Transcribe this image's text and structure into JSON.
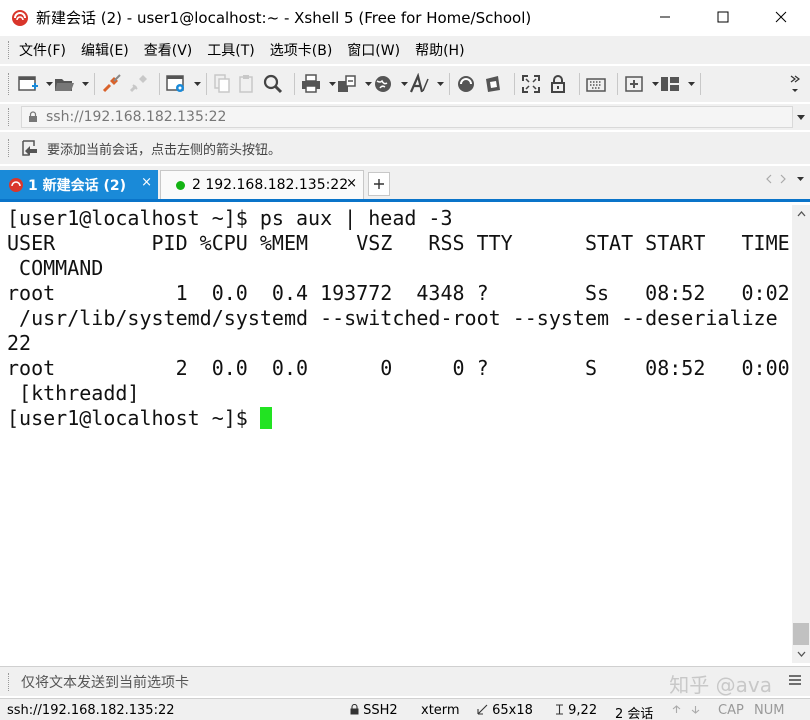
{
  "window": {
    "title": "新建会话 (2) - user1@localhost:~ - Xshell 5 (Free for Home/School)"
  },
  "menu": [
    "文件(F)",
    "编辑(E)",
    "查看(V)",
    "工具(T)",
    "选项卡(B)",
    "窗口(W)",
    "帮助(H)"
  ],
  "address": {
    "value": "ssh://192.168.182.135:22"
  },
  "hint": {
    "text": "要添加当前会话，点击左侧的箭头按钮。"
  },
  "tabs": [
    {
      "label": "1 新建会话 (2)",
      "active": true
    },
    {
      "label": "2 192.168.182.135:22",
      "active": false,
      "status_color": "#13b313"
    }
  ],
  "terminal": {
    "lines": [
      "[user1@localhost ~]$ ps aux | head -3",
      "USER        PID %CPU %MEM    VSZ   RSS TTY      STAT START   TIME",
      " COMMAND",
      "root          1  0.0  0.4 193772  4348 ?        Ss   08:52   0:02",
      " /usr/lib/systemd/systemd --switched-root --system --deserialize",
      "22",
      "root          2  0.0  0.0      0     0 ?        S    08:52   0:00",
      " [kthreadd]"
    ],
    "prompt": "[user1@localhost ~]$ ",
    "cursor_color": "#22e322"
  },
  "compose": {
    "placeholder": "仅将文本发送到当前选项卡",
    "watermark": "知乎 @ava"
  },
  "status": {
    "connection": "ssh://192.168.182.135:22",
    "protocol": "SSH2",
    "terminal_type": "xterm",
    "size": "65x18",
    "position": "9,22",
    "sessions": "2 会话",
    "caps": "CAP",
    "num": "NUM"
  },
  "colors": {
    "accent": "#1a8ad8",
    "tab_underline": "#0a74c9",
    "cursor": "#22e322"
  }
}
